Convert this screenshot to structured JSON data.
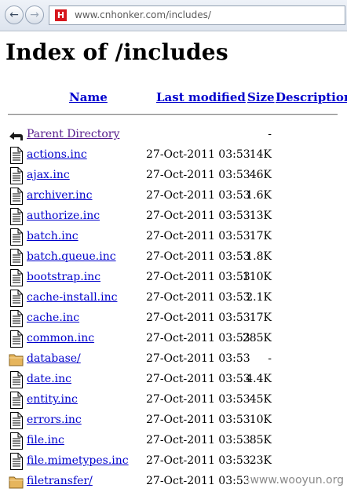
{
  "browser": {
    "back_icon": "back-arrow-icon",
    "forward_icon": "forward-arrow-icon",
    "favicon_icon": "cnhonker-favicon-icon",
    "url": "www.cnhonker.com/includes/"
  },
  "page": {
    "title": "Index of /includes",
    "headers": {
      "name": "Name",
      "last_modified": "Last modified",
      "size": "Size",
      "description": "Description"
    }
  },
  "parent": {
    "icon": "back-folder-icon",
    "label": "Parent Directory",
    "size": "-"
  },
  "files": [
    {
      "icon": "file-icon",
      "name": "actions.inc",
      "date": "27-Oct-2011 03:53",
      "size": "14K"
    },
    {
      "icon": "file-icon",
      "name": "ajax.inc",
      "date": "27-Oct-2011 03:53",
      "size": "46K"
    },
    {
      "icon": "file-icon",
      "name": "archiver.inc",
      "date": "27-Oct-2011 03:53",
      "size": "1.6K"
    },
    {
      "icon": "file-icon",
      "name": "authorize.inc",
      "date": "27-Oct-2011 03:53",
      "size": "13K"
    },
    {
      "icon": "file-icon",
      "name": "batch.inc",
      "date": "27-Oct-2011 03:53",
      "size": "17K"
    },
    {
      "icon": "file-icon",
      "name": "batch.queue.inc",
      "date": "27-Oct-2011 03:53",
      "size": "1.8K"
    },
    {
      "icon": "file-icon",
      "name": "bootstrap.inc",
      "date": "27-Oct-2011 03:53",
      "size": "110K"
    },
    {
      "icon": "file-icon",
      "name": "cache-install.inc",
      "date": "27-Oct-2011 03:53",
      "size": "2.1K"
    },
    {
      "icon": "file-icon",
      "name": "cache.inc",
      "date": "27-Oct-2011 03:53",
      "size": "17K"
    },
    {
      "icon": "file-icon",
      "name": "common.inc",
      "date": "27-Oct-2011 03:53",
      "size": "285K"
    },
    {
      "icon": "folder-icon",
      "name": "database/",
      "date": "27-Oct-2011 03:53",
      "size": "-"
    },
    {
      "icon": "file-icon",
      "name": "date.inc",
      "date": "27-Oct-2011 03:53",
      "size": "4.4K"
    },
    {
      "icon": "file-icon",
      "name": "entity.inc",
      "date": "27-Oct-2011 03:53",
      "size": "45K"
    },
    {
      "icon": "file-icon",
      "name": "errors.inc",
      "date": "27-Oct-2011 03:53",
      "size": "10K"
    },
    {
      "icon": "file-icon",
      "name": "file.inc",
      "date": "27-Oct-2011 03:53",
      "size": "85K"
    },
    {
      "icon": "file-icon",
      "name": "file.mimetypes.inc",
      "date": "27-Oct-2011 03:53",
      "size": "23K"
    },
    {
      "icon": "folder-icon",
      "name": "filetransfer/",
      "date": "27-Oct-2011 03:53",
      "size": ""
    }
  ],
  "watermark": "www.wooyun.org"
}
